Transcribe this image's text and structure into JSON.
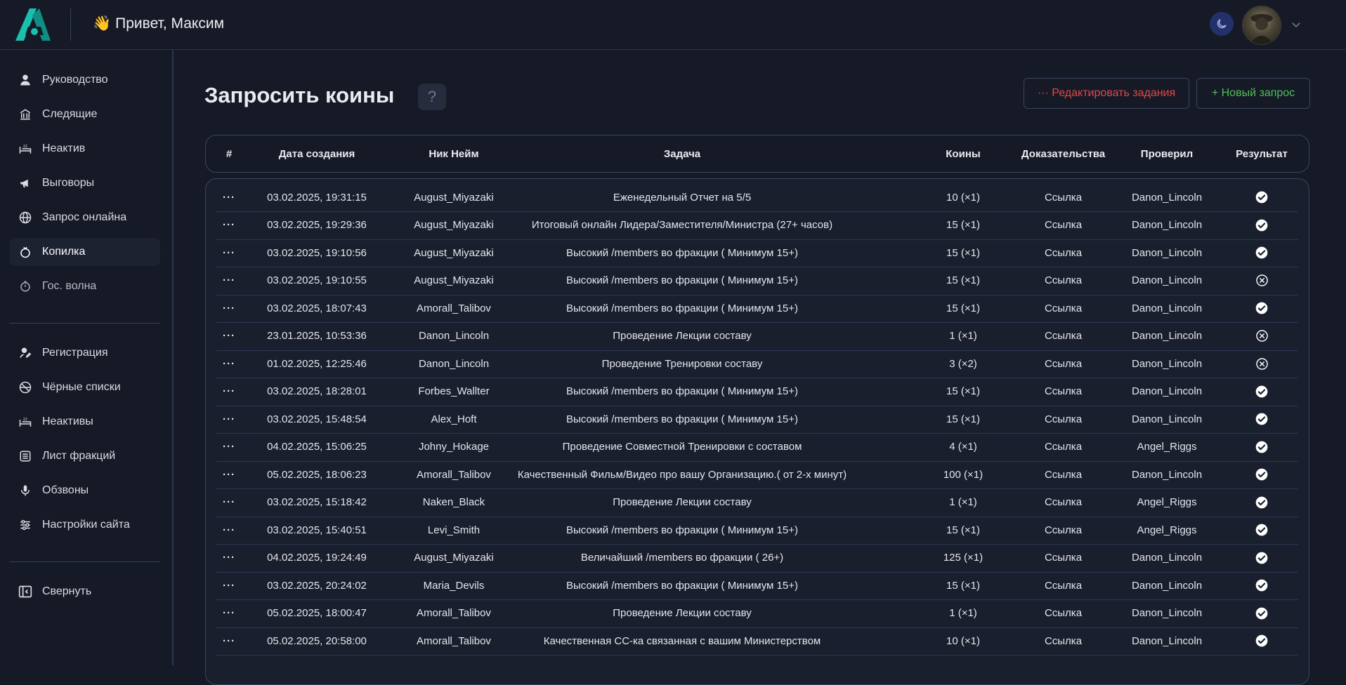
{
  "header": {
    "greeting_emoji": "👋",
    "greeting": "Привет, Максим"
  },
  "sidebar": {
    "group1": [
      {
        "label": "Руководство",
        "icon": "user-icon"
      },
      {
        "label": "Следящие",
        "icon": "building-icon"
      },
      {
        "label": "Неактив",
        "icon": "sleep-icon"
      },
      {
        "label": "Выговоры",
        "icon": "megaphone-icon"
      },
      {
        "label": "Запрос онлайна",
        "icon": "globe-icon"
      },
      {
        "label": "Копилка",
        "icon": "piggy-bank-icon"
      },
      {
        "label": "Гос. волна",
        "icon": "stopwatch-icon"
      }
    ],
    "group2": [
      {
        "label": "Регистрация",
        "icon": "user-edit-icon"
      },
      {
        "label": "Чёрные списки",
        "icon": "ban-globe-icon"
      },
      {
        "label": "Неактивы",
        "icon": "sleep-icon"
      },
      {
        "label": "Лист фракций",
        "icon": "list-icon"
      },
      {
        "label": "Обзвоны",
        "icon": "microphone-icon"
      },
      {
        "label": "Настройки сайта",
        "icon": "sliders-icon"
      }
    ],
    "collapse": "Свернуть",
    "active": "Копилка"
  },
  "main": {
    "title": "Запросить коины",
    "help": "?",
    "edit_button": "··· Редактировать задания",
    "new_button": "+ Новый запрос"
  },
  "table": {
    "columns": [
      "#",
      "Дата создания",
      "Ник Нейм",
      "Задача",
      "Коины",
      "Доказательства",
      "Проверил",
      "Результат"
    ],
    "rows": [
      {
        "menu": "···",
        "date": "03.02.2025, 19:31:15",
        "nick": "August_Miyazaki",
        "task": "Еженедельный Отчет на 5/5",
        "coins": "10 (×1)",
        "proof": "Ссылка",
        "checker": "Danon_Lincoln",
        "result": "approved"
      },
      {
        "menu": "···",
        "date": "03.02.2025, 19:29:36",
        "nick": "August_Miyazaki",
        "task": "Итоговый онлайн Лидера/Заместителя/Министра (27+ часов)",
        "coins": "15 (×1)",
        "proof": "Ссылка",
        "checker": "Danon_Lincoln",
        "result": "approved"
      },
      {
        "menu": "···",
        "date": "03.02.2025, 19:10:56",
        "nick": "August_Miyazaki",
        "task": "Высокий /members во фракции ( Минимум 15+)",
        "coins": "15 (×1)",
        "proof": "Ссылка",
        "checker": "Danon_Lincoln",
        "result": "approved"
      },
      {
        "menu": "···",
        "date": "03.02.2025, 19:10:55",
        "nick": "August_Miyazaki",
        "task": "Высокий /members во фракции ( Минимум 15+)",
        "coins": "15 (×1)",
        "proof": "Ссылка",
        "checker": "Danon_Lincoln",
        "result": "rejected"
      },
      {
        "menu": "···",
        "date": "03.02.2025, 18:07:43",
        "nick": "Amorall_Talibov",
        "task": "Высокий /members во фракции ( Минимум 15+)",
        "coins": "15 (×1)",
        "proof": "Ссылка",
        "checker": "Danon_Lincoln",
        "result": "approved"
      },
      {
        "menu": "···",
        "date": "23.01.2025, 10:53:36",
        "nick": "Danon_Lincoln",
        "task": "Проведение Лекции составу",
        "coins": "1 (×1)",
        "proof": "Ссылка",
        "checker": "Danon_Lincoln",
        "result": "rejected"
      },
      {
        "menu": "···",
        "date": "01.02.2025, 12:25:46",
        "nick": "Danon_Lincoln",
        "task": "Проведение Тренировки составу",
        "coins": "3 (×2)",
        "proof": "Ссылка",
        "checker": "Danon_Lincoln",
        "result": "rejected"
      },
      {
        "menu": "···",
        "date": "03.02.2025, 18:28:01",
        "nick": "Forbes_Wallter",
        "task": "Высокий /members во фракции ( Минимум 15+)",
        "coins": "15 (×1)",
        "proof": "Ссылка",
        "checker": "Danon_Lincoln",
        "result": "approved"
      },
      {
        "menu": "···",
        "date": "03.02.2025, 15:48:54",
        "nick": "Alex_Hoft",
        "task": "Высокий /members во фракции ( Минимум 15+)",
        "coins": "15 (×1)",
        "proof": "Ссылка",
        "checker": "Danon_Lincoln",
        "result": "approved"
      },
      {
        "menu": "···",
        "date": "04.02.2025, 15:06:25",
        "nick": "Johny_Hokage",
        "task": "Проведение Совместной Тренировки с составом",
        "coins": "4 (×1)",
        "proof": "Ссылка",
        "checker": "Angel_Riggs",
        "result": "approved"
      },
      {
        "menu": "···",
        "date": "05.02.2025, 18:06:23",
        "nick": "Amorall_Talibov",
        "task": "Качественный Фильм/Видео про вашу Организацию.( от 2-х минут)",
        "coins": "100 (×1)",
        "proof": "Ссылка",
        "checker": "Danon_Lincoln",
        "result": "approved"
      },
      {
        "menu": "···",
        "date": "03.02.2025, 15:18:42",
        "nick": "Naken_Black",
        "task": "Проведение Лекции составу",
        "coins": "1 (×1)",
        "proof": "Ссылка",
        "checker": "Angel_Riggs",
        "result": "approved"
      },
      {
        "menu": "···",
        "date": "03.02.2025, 15:40:51",
        "nick": "Levi_Smith",
        "task": "Высокий /members во фракции ( Минимум 15+)",
        "coins": "15 (×1)",
        "proof": "Ссылка",
        "checker": "Angel_Riggs",
        "result": "approved"
      },
      {
        "menu": "···",
        "date": "04.02.2025, 19:24:49",
        "nick": "August_Miyazaki",
        "task": "Величайший /members во фракции ( 26+)",
        "coins": "125 (×1)",
        "proof": "Ссылка",
        "checker": "Danon_Lincoln",
        "result": "approved"
      },
      {
        "menu": "···",
        "date": "03.02.2025, 20:24:02",
        "nick": "Maria_Devils",
        "task": "Высокий /members во фракции ( Минимум 15+)",
        "coins": "15 (×1)",
        "proof": "Ссылка",
        "checker": "Danon_Lincoln",
        "result": "approved"
      },
      {
        "menu": "···",
        "date": "05.02.2025, 18:00:47",
        "nick": "Amorall_Talibov",
        "task": "Проведение Лекции составу",
        "coins": "1 (×1)",
        "proof": "Ссылка",
        "checker": "Danon_Lincoln",
        "result": "approved"
      },
      {
        "menu": "···",
        "date": "05.02.2025, 20:58:00",
        "nick": "Amorall_Talibov",
        "task": "Качественная СС-ка связанная с вашим Министерством",
        "coins": "10 (×1)",
        "proof": "Ссылка",
        "checker": "Danon_Lincoln",
        "result": "approved"
      }
    ]
  },
  "colors": {
    "background": "#161a26",
    "table_body": "#1a1f2e",
    "accent_teal": "#1bbfae",
    "edit_red": "#e0474c",
    "new_green": "#4fbf57",
    "moon_bg": "#23316b"
  }
}
